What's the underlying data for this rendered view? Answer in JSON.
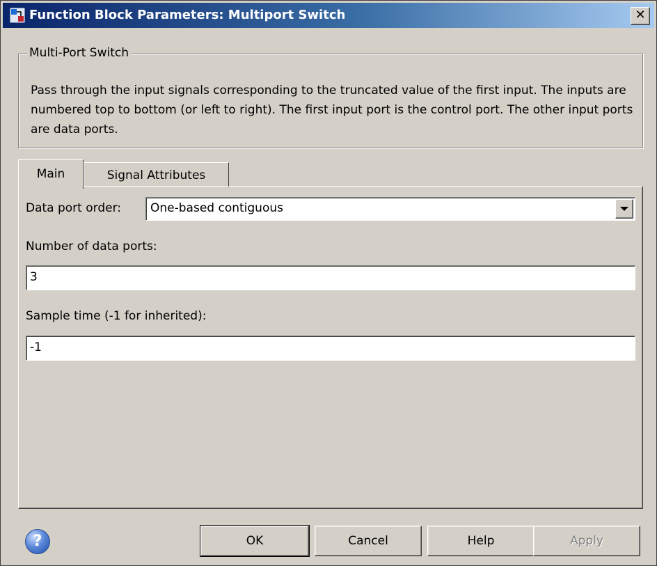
{
  "window": {
    "title": "Function Block Parameters: Multiport Switch",
    "close_label": "✕"
  },
  "group": {
    "legend": "Multi-Port Switch",
    "description": "Pass through the input signals corresponding to the truncated value of the first input. The inputs are numbered top to bottom (or left to right). The first input port is the control port. The other input ports are data ports."
  },
  "tabs": [
    {
      "label": "Main"
    },
    {
      "label": "Signal Attributes"
    }
  ],
  "params": {
    "data_port_order_label": "Data port order:",
    "data_port_order_value": "One-based contiguous",
    "num_ports_label": "Number of data ports:",
    "num_ports_value": "3",
    "sample_time_label": "Sample time (-1 for inherited):",
    "sample_time_value": "-1"
  },
  "buttons": {
    "help_icon": "?",
    "ok": "OK",
    "cancel": "Cancel",
    "help": "Help",
    "apply": "Apply"
  }
}
